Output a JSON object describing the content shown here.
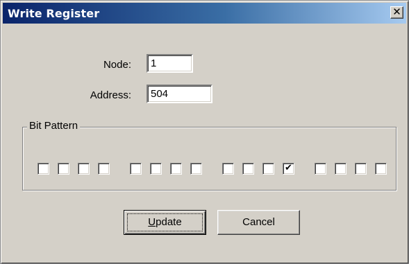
{
  "window": {
    "title": "Write Register",
    "close_glyph": "✕",
    "close_icon": "close-icon"
  },
  "form": {
    "node_label": "Node:",
    "node_value": "1",
    "address_label": "Address:",
    "address_value": "504"
  },
  "bit_pattern": {
    "label": "Bit Pattern",
    "bits": [
      false,
      false,
      false,
      false,
      false,
      false,
      false,
      false,
      false,
      false,
      false,
      true,
      false,
      false,
      false,
      false
    ]
  },
  "buttons": {
    "update": "Update",
    "update_mnemonic": "U",
    "cancel": "Cancel"
  }
}
